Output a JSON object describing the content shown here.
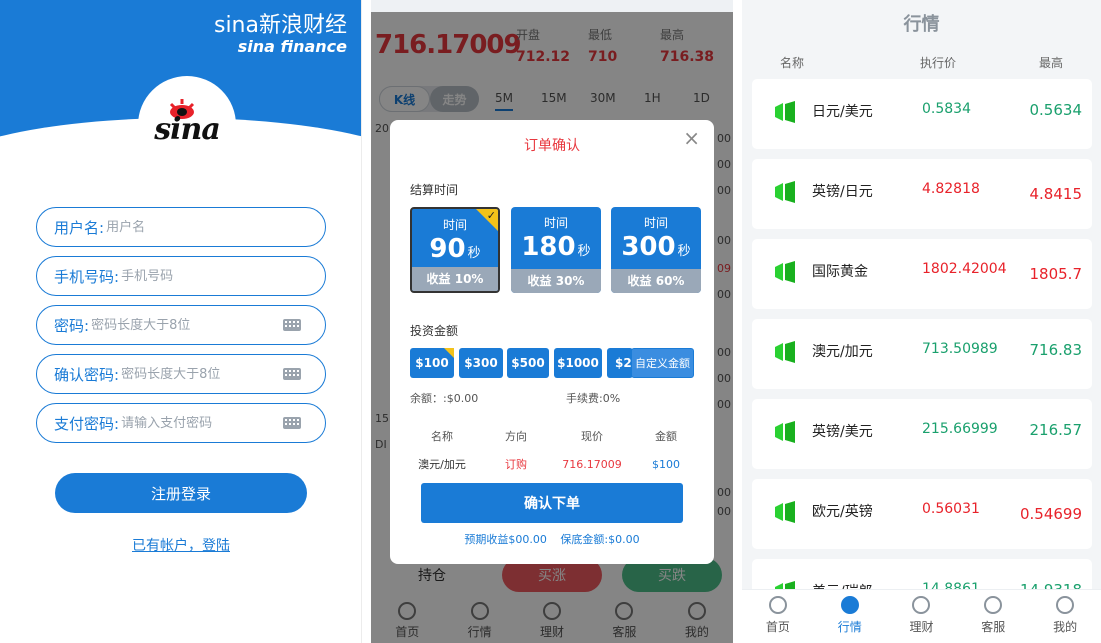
{
  "panel1": {
    "brand_cn": "新浪财经",
    "brand_sina": "sina",
    "brand_en": "sina finance",
    "logo_text": "sina",
    "fields": [
      {
        "label": "用户名:",
        "placeholder": "用户名"
      },
      {
        "label": "手机号码:",
        "placeholder": "手机号码"
      },
      {
        "label": "密码:",
        "placeholder": "密码长度大于8位"
      },
      {
        "label": "确认密码:",
        "placeholder": "密码长度大于8位"
      },
      {
        "label": "支付密码:",
        "placeholder": "请输入支付密码"
      }
    ],
    "register_button": "注册登录",
    "login_link": "已有帐户，登陆"
  },
  "panel2": {
    "price": "716.17009",
    "stats": [
      {
        "label": "开盘",
        "value": "712.12"
      },
      {
        "label": "最低",
        "value": "710"
      },
      {
        "label": "最高",
        "value": "716.38"
      }
    ],
    "chart_tabs": [
      "K线",
      "走势"
    ],
    "periods": [
      "5M",
      "15M",
      "30M",
      "1H",
      "1D"
    ],
    "axis_left": [
      "20",
      "15",
      "DI"
    ],
    "axis_right": [
      "00",
      "00",
      "00",
      "00",
      "09",
      "00",
      "00",
      "00",
      "00",
      "00",
      "00"
    ],
    "bottom_buttons": [
      "持仓",
      "买涨",
      "买跌"
    ],
    "nav": [
      "首页",
      "行情",
      "理财",
      "客服",
      "我的"
    ],
    "modal": {
      "title": "订单确认",
      "close": "×",
      "settle_label": "结算时间",
      "cards": [
        {
          "label": "时间",
          "seconds": "90",
          "unit": "秒",
          "profit": "收益 10%",
          "selected": true
        },
        {
          "label": "时间",
          "seconds": "180",
          "unit": "秒",
          "profit": "收益 30%",
          "selected": false
        },
        {
          "label": "时间",
          "seconds": "300",
          "unit": "秒",
          "profit": "收益 60%",
          "selected": false
        }
      ],
      "amount_label": "投资金额",
      "amounts": [
        "$100",
        "$300",
        "$500",
        "$1000",
        "$2"
      ],
      "custom_amount": "自定义金额",
      "balance": "余额：:$0.00",
      "fee": "手续费:0%",
      "table_headers": [
        "名称",
        "方向",
        "现价",
        "金额"
      ],
      "table_row": [
        "澳元/加元",
        "订购",
        "716.17009",
        "$100"
      ],
      "confirm_button": "确认下单",
      "expected": "预期收益$00.00",
      "guarantee": "保底金额:$0.00"
    }
  },
  "panel3": {
    "title": "行情",
    "headers": [
      "名称",
      "执行价",
      "最高"
    ],
    "items": [
      {
        "name": "日元/美元",
        "exec": "0.5834",
        "high": "0.5634",
        "color": "#1aa06d"
      },
      {
        "name": "英镑/日元",
        "exec": "4.82818",
        "high": "4.8415",
        "color": "#e8222a"
      },
      {
        "name": "国际黄金",
        "exec": "1802.42004",
        "high": "1805.7",
        "color": "#e8222a"
      },
      {
        "name": "澳元/加元",
        "exec": "713.50989",
        "high": "716.83",
        "color": "#1aa06d"
      },
      {
        "name": "英镑/美元",
        "exec": "215.66999",
        "high": "216.57",
        "color": "#1aa06d"
      },
      {
        "name": "欧元/英镑",
        "exec": "0.56031",
        "high": "0.54699",
        "color": "#e8222a"
      },
      {
        "name": "美元/瑞郎",
        "exec": "14.8861",
        "high": "14.9318",
        "color": "#1aa06d"
      }
    ],
    "nav": [
      "首页",
      "行情",
      "理财",
      "客服",
      "我的"
    ],
    "active_nav": "行情"
  },
  "colors": {
    "brand_blue": "#1a7bd6",
    "up_red": "#e8222a",
    "down_green": "#1aa06d"
  }
}
